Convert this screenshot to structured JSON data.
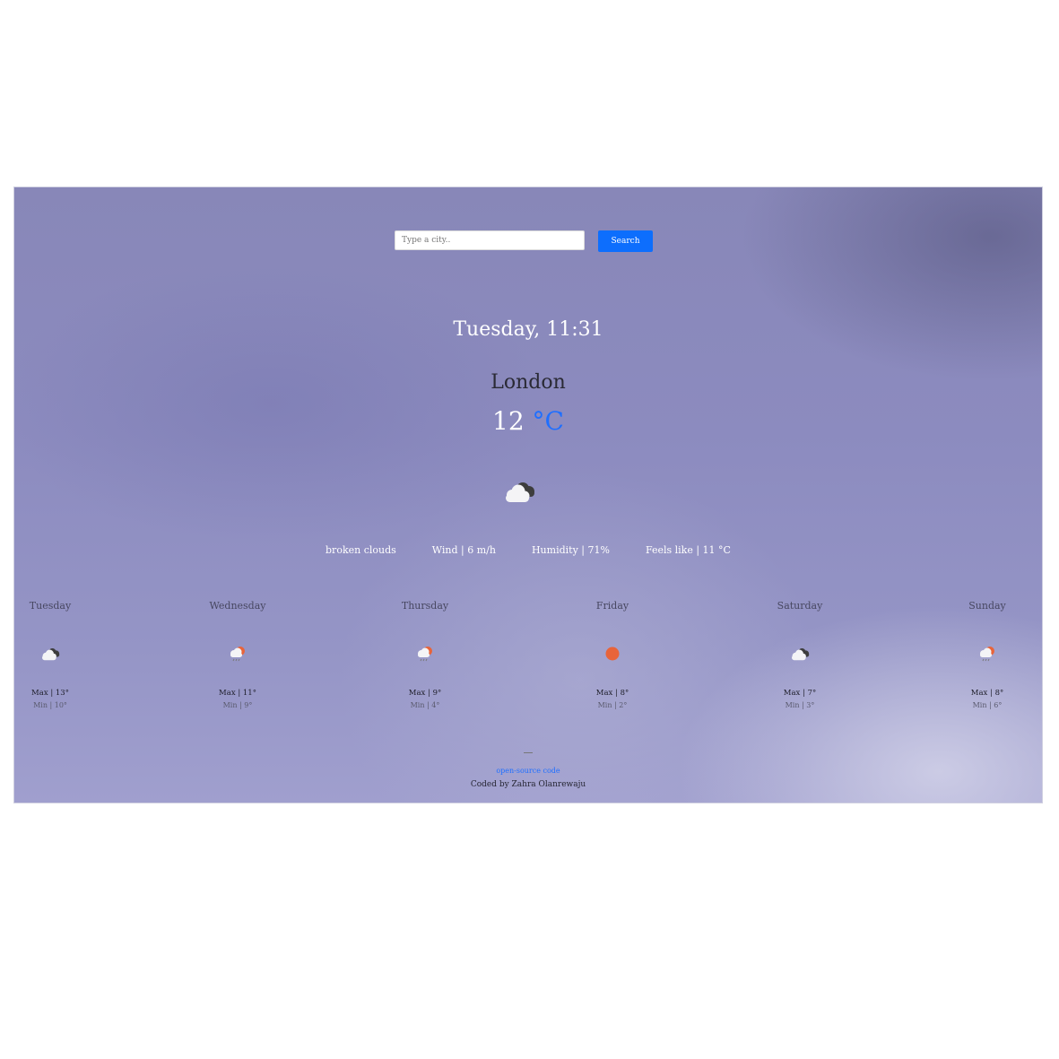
{
  "search": {
    "placeholder": "Type a city..",
    "button_label": "Search"
  },
  "current": {
    "datetime": "Tuesday, 11:31",
    "city": "London",
    "temperature": "12",
    "unit": "°C",
    "icon": "broken-clouds-icon",
    "description": "broken clouds",
    "wind": "Wind | 6 m/h",
    "humidity": "Humidity | 71%",
    "feels_like": "Feels like | 11 °C"
  },
  "forecast": [
    {
      "day": "Tuesday",
      "icon": "broken-clouds-icon",
      "max": "Max | 13°",
      "min": "Min | 10°"
    },
    {
      "day": "Wednesday",
      "icon": "rain-sun-icon",
      "max": "Max | 11°",
      "min": "Min | 9°"
    },
    {
      "day": "Thursday",
      "icon": "rain-sun-icon",
      "max": "Max | 9°",
      "min": "Min | 4°"
    },
    {
      "day": "Friday",
      "icon": "clear-sun-icon",
      "max": "Max | 8°",
      "min": "Min | 2°"
    },
    {
      "day": "Saturday",
      "icon": "broken-clouds-icon",
      "max": "Max | 7°",
      "min": "Min | 3°"
    },
    {
      "day": "Sunday",
      "icon": "rain-sun-icon",
      "max": "Max | 8°",
      "min": "Min | 6°"
    }
  ],
  "footer": {
    "link_text": "open-source code",
    "credit": "Coded by Zahra Olanrewaju"
  },
  "colors": {
    "accent": "#0d6efd",
    "sun": "#e8643a",
    "cloud_dark": "#3d3d3d",
    "cloud_light": "#f2f2f2"
  }
}
